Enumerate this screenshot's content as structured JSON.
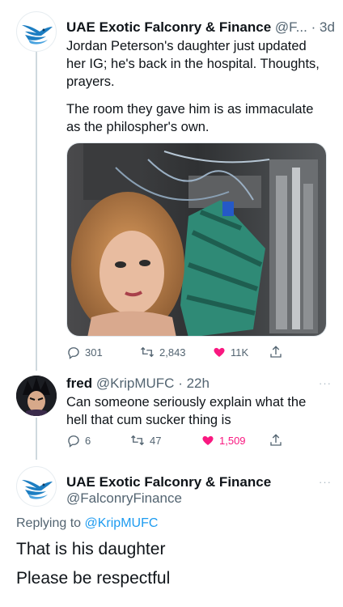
{
  "tweet1": {
    "name": "UAE Exotic Falconry & Finance",
    "handle": "@F...",
    "sep": "·",
    "time": "3d",
    "text_p1": "Jordan Peterson's daughter just updated her IG; he's back in the hospital. Thoughts, prayers.",
    "text_p2": "The room they gave him is as immaculate as the philospher's own.",
    "replies": "301",
    "retweets": "2,843",
    "likes": "11K"
  },
  "tweet2": {
    "name": "fred",
    "handle": "@KripMUFC",
    "sep": "·",
    "time": "22h",
    "text": "Can someone seriously explain what the hell that cum sucker thing is",
    "replies": "6",
    "retweets": "47",
    "likes": "1,509"
  },
  "tweet3": {
    "name": "UAE Exotic Falconry & Finance",
    "handle": "@FalconryFinance",
    "replying_prefix": "Replying to",
    "replying_to": "@KripMUFC",
    "line1": "That is his daughter",
    "line2": "Please be respectful"
  },
  "more_label": "···",
  "colors": {
    "text": "#0f1419",
    "secondary": "#536471",
    "accent": "#1d9bf0",
    "like": "#f91880",
    "thread_line": "#cfd9de"
  },
  "icons": [
    "falcon-logo-icon",
    "reply-icon",
    "retweet-icon",
    "like-icon",
    "share-icon",
    "more-icon"
  ]
}
